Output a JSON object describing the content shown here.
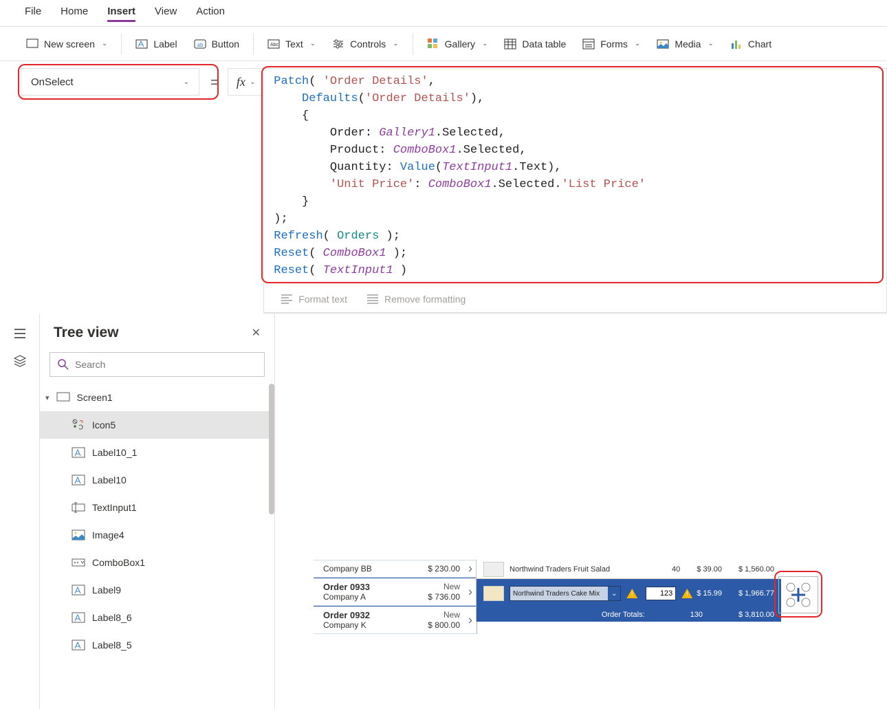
{
  "menubar": {
    "items": [
      {
        "label": "File"
      },
      {
        "label": "Home"
      },
      {
        "label": "Insert",
        "active": true
      },
      {
        "label": "View"
      },
      {
        "label": "Action"
      }
    ]
  },
  "ribbon": {
    "new_screen": "New screen",
    "label": "Label",
    "button": "Button",
    "text": "Text",
    "controls": "Controls",
    "gallery": "Gallery",
    "data_table": "Data table",
    "forms": "Forms",
    "media": "Media",
    "chart": "Chart"
  },
  "property_dropdown": {
    "value": "OnSelect"
  },
  "tree": {
    "title": "Tree view",
    "search_placeholder": "Search",
    "items": [
      {
        "label": "Screen1",
        "type": "screen"
      },
      {
        "label": "Icon5",
        "type": "addicon",
        "selected": true
      },
      {
        "label": "Label10_1",
        "type": "label"
      },
      {
        "label": "Label10",
        "type": "label"
      },
      {
        "label": "TextInput1",
        "type": "textinput"
      },
      {
        "label": "Image4",
        "type": "image"
      },
      {
        "label": "ComboBox1",
        "type": "combobox"
      },
      {
        "label": "Label9",
        "type": "label"
      },
      {
        "label": "Label8_6",
        "type": "label"
      },
      {
        "label": "Label8_5",
        "type": "label"
      }
    ]
  },
  "formula": {
    "l1a": "Patch",
    "l1b": "( ",
    "l1c": "'Order Details'",
    "l1d": ",",
    "l2a": "    Defaults",
    "l2b": "(",
    "l2c": "'Order Details'",
    "l2d": "),",
    "l3": "    {",
    "l4a": "        Order: ",
    "l4b": "Gallery1",
    "l4c": ".Selected,",
    "l5a": "        Product: ",
    "l5b": "ComboBox1",
    "l5c": ".Selected,",
    "l6a": "        Quantity: ",
    "l6b": "Value",
    "l6c": "(",
    "l6d": "TextInput1",
    "l6e": ".Text),",
    "l7a": "        ",
    "l7b": "'Unit Price'",
    "l7c": ": ",
    "l7d": "ComboBox1",
    "l7e": ".Selected.",
    "l7f": "'List Price'",
    "l8": "    }",
    "l9": ");",
    "l10a": "Refresh",
    "l10b": "( ",
    "l10c": "Orders ",
    "l10d": ");",
    "l11a": "Reset",
    "l11b": "( ",
    "l11c": "ComboBox1 ",
    "l11d": ");",
    "l12a": "Reset",
    "l12b": "( ",
    "l12c": "TextInput1 ",
    "l12d": ")"
  },
  "fmtbar": {
    "format": "Format text",
    "remove": "Remove formatting"
  },
  "gallery": [
    {
      "title": "Company BB",
      "sub": "",
      "amount": "$ 230.00",
      "new": ""
    },
    {
      "title": "Order 0933",
      "sub": "Company A",
      "amount": "$ 736.00",
      "new": "New"
    },
    {
      "title": "Order 0932",
      "sub": "Company K",
      "amount": "$ 800.00",
      "new": "New"
    }
  ],
  "details": {
    "row1": {
      "name": "Northwind Traders Fruit Salad",
      "qty": "40",
      "price": "$ 39.00",
      "total": "$ 1,560.00"
    },
    "row2": {
      "combo": "Northwind Traders Cake Mix",
      "qty": "123",
      "price": "$ 15.99",
      "total": "$ 1,966.77"
    },
    "row3": {
      "label": "Order Totals:",
      "qty": "130",
      "total": "$ 3,810.00"
    }
  }
}
